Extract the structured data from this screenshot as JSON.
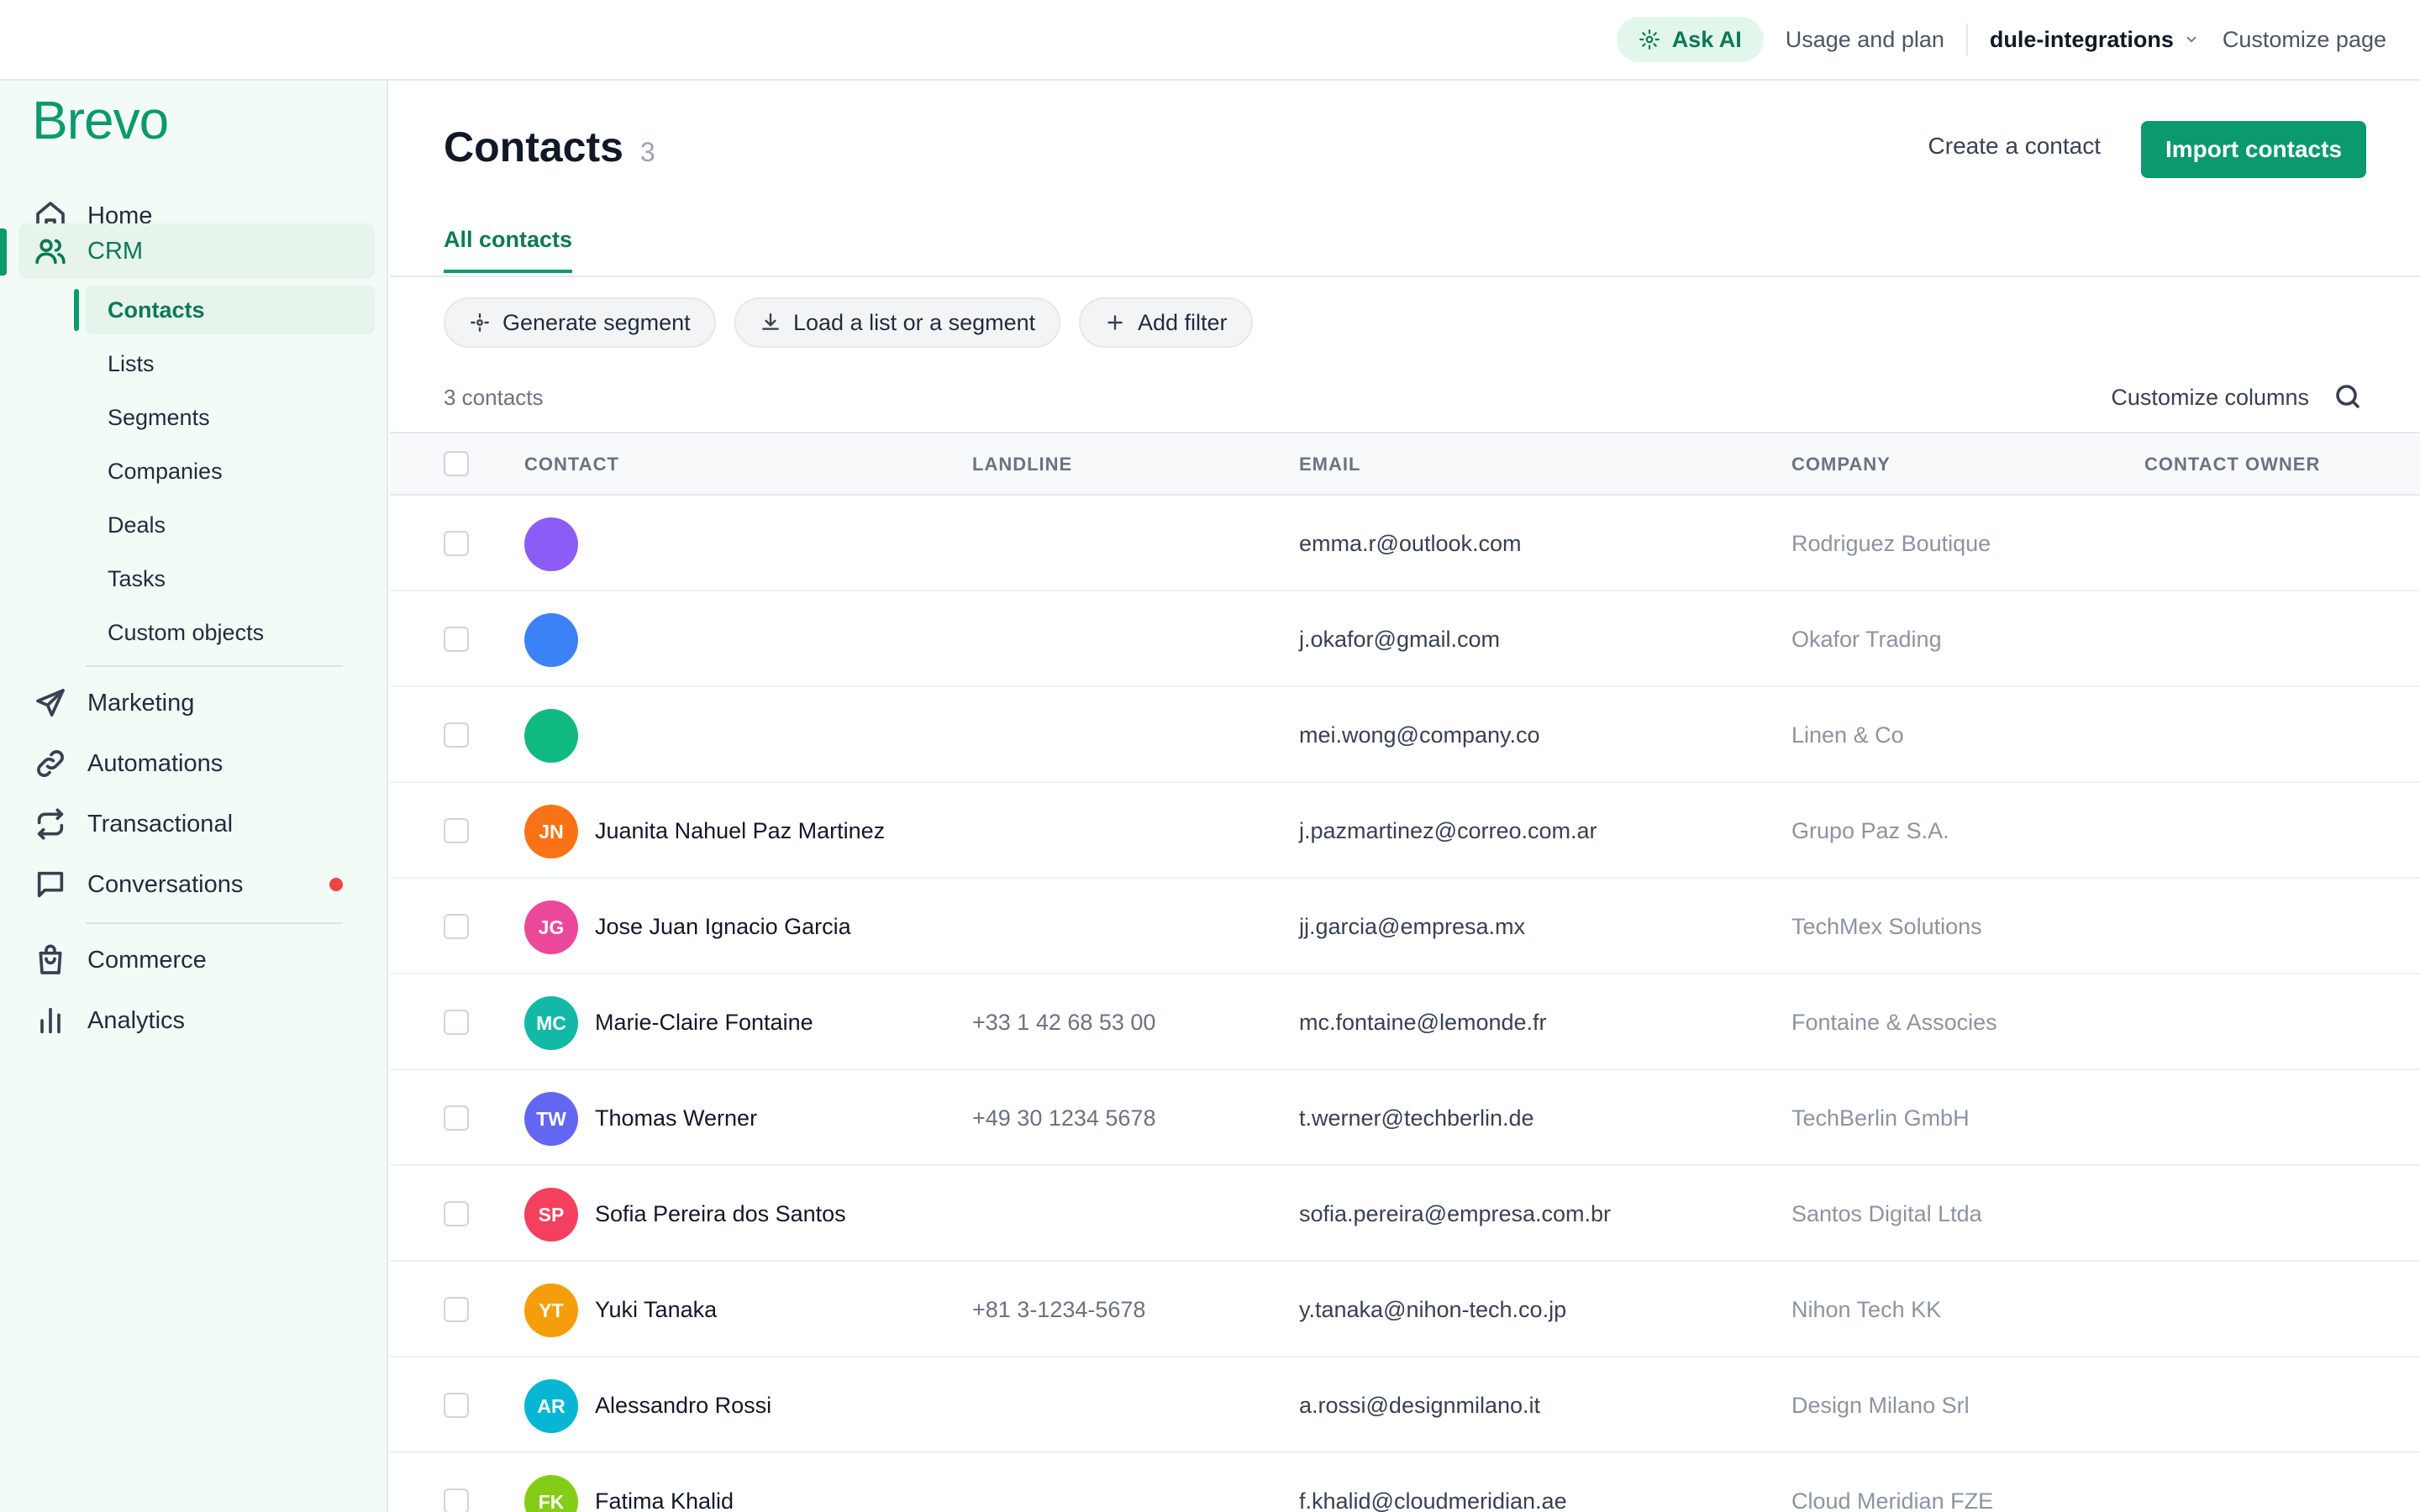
{
  "topbar": {
    "ask_ai": "Ask AI",
    "usage": "Usage and plan",
    "account": "dule-integrations",
    "customize": "Customize page"
  },
  "sidebar": {
    "logo": "Brevo",
    "home": "Home",
    "crm": "CRM",
    "crm_items": [
      "Contacts",
      "Lists",
      "Segments",
      "Companies",
      "Deals",
      "Tasks",
      "Custom objects"
    ],
    "marketing": "Marketing",
    "automations": "Automations",
    "transactional": "Transactional",
    "conversations": "Conversations",
    "commerce": "Commerce",
    "analytics": "Analytics"
  },
  "main": {
    "title": "Contacts",
    "title_count": "3",
    "create_contact": "Create a contact",
    "import_contacts": "Import contacts",
    "tab_all": "All contacts",
    "generate_segment": "Generate segment",
    "load_list": "Load a list or a segment",
    "add_filter": "Add filter",
    "contacts_count": "3 contacts",
    "customize_columns": "Customize columns"
  },
  "table": {
    "headers": {
      "contact": "CONTACT",
      "landline": "LANDLINE",
      "email": "EMAIL",
      "company": "COMPANY",
      "owner": "CONTACT OWNER"
    },
    "rows": [
      {
        "initials": "",
        "color": "#8b5cf6",
        "name": "",
        "landline": "",
        "email": "emma.r@outlook.com",
        "company": "Rodriguez Boutique"
      },
      {
        "initials": "",
        "color": "#3b82f6",
        "name": "",
        "landline": "",
        "email": "j.okafor@gmail.com",
        "company": "Okafor Trading"
      },
      {
        "initials": "",
        "color": "#10b981",
        "name": "",
        "landline": "",
        "email": "mei.wong@company.co",
        "company": "Linen & Co"
      },
      {
        "initials": "JN",
        "color": "#f97316",
        "name": "Juanita Nahuel Paz Martinez",
        "landline": "",
        "email": "j.pazmartinez@correo.com.ar",
        "company": "Grupo Paz S.A."
      },
      {
        "initials": "JG",
        "color": "#ec4899",
        "name": "Jose Juan Ignacio Garcia",
        "landline": "",
        "email": "jj.garcia@empresa.mx",
        "company": "TechMex Solutions"
      },
      {
        "initials": "MC",
        "color": "#14b8a6",
        "name": "Marie-Claire Fontaine",
        "landline": "+33 1 42 68 53 00",
        "email": "mc.fontaine@lemonde.fr",
        "company": "Fontaine & Associes"
      },
      {
        "initials": "TW",
        "color": "#6366f1",
        "name": "Thomas Werner",
        "landline": "+49 30 1234 5678",
        "email": "t.werner@techberlin.de",
        "company": "TechBerlin GmbH"
      },
      {
        "initials": "SP",
        "color": "#f43f5e",
        "name": "Sofia Pereira dos Santos",
        "landline": "",
        "email": "sofia.pereira@empresa.com.br",
        "company": "Santos Digital Ltda"
      },
      {
        "initials": "YT",
        "color": "#f59e0b",
        "name": "Yuki Tanaka",
        "landline": "+81 3-1234-5678",
        "email": "y.tanaka@nihon-tech.co.jp",
        "company": "Nihon Tech KK"
      },
      {
        "initials": "AR",
        "color": "#06b6d4",
        "name": "Alessandro Rossi",
        "landline": "",
        "email": "a.rossi@designmilano.it",
        "company": "Design Milano Srl"
      },
      {
        "initials": "FK",
        "color": "#84cc16",
        "name": "Fatima Khalid",
        "landline": "",
        "email": "f.khalid@cloudmeridian.ae",
        "company": "Cloud Meridian FZE"
      }
    ]
  }
}
